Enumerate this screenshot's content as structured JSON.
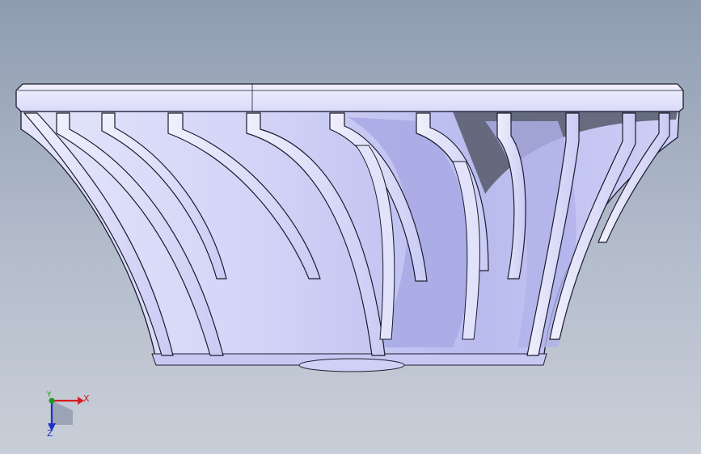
{
  "viewport": {
    "background_top": "#8f9cb0",
    "background_bottom": "#c9cfd8",
    "model": {
      "name": "impeller",
      "body_color": "#cfd0f6",
      "shade_color": "#a9abe6",
      "edge_color": "#1c1c2e"
    }
  },
  "triad": {
    "x_label": "X",
    "y_label": "Y",
    "z_label": "Z",
    "x_color": "#d42020",
    "y_color": "#1a9a1a",
    "z_color": "#2030c8"
  }
}
